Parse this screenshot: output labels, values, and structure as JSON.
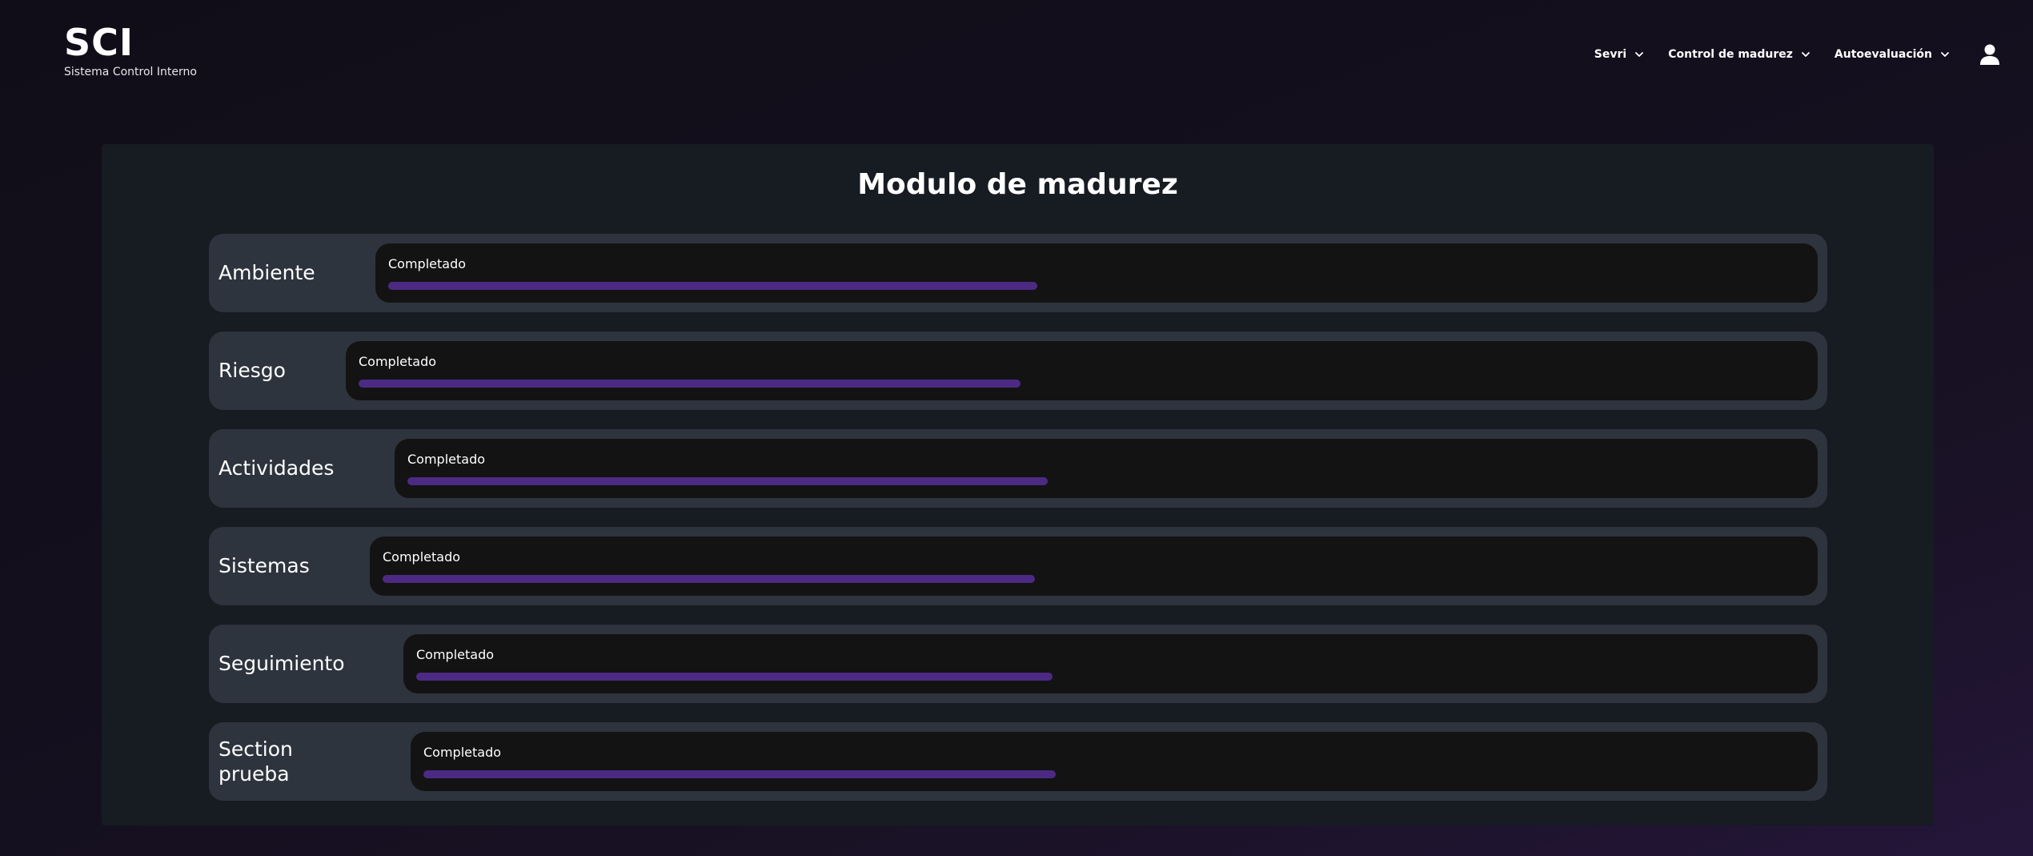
{
  "brand": {
    "logo": "SCI",
    "tagline": "Sistema Control Interno"
  },
  "nav": {
    "items": [
      {
        "label": "Sevri",
        "icon": "chevron-down-icon"
      },
      {
        "label": "Control de madurez",
        "icon": "chevron-down-icon"
      },
      {
        "label": "Autoevaluación",
        "icon": "chevron-down-icon"
      }
    ],
    "user_icon": "user-icon"
  },
  "main": {
    "title": "Modulo de madurez",
    "sections": [
      {
        "name": "Ambiente",
        "status": "Completado",
        "progress": 0.45
      },
      {
        "name": "Riesgo",
        "status": "Completado",
        "progress": 0.45
      },
      {
        "name": "Actividades",
        "status": "Completado",
        "progress": 0.45
      },
      {
        "name": "Sistemas",
        "status": "Completado",
        "progress": 0.45
      },
      {
        "name": "Seguimiento",
        "status": "Completado",
        "progress": 0.45
      },
      {
        "name": "Section prueba",
        "status": "Completado",
        "progress": 0.45
      }
    ]
  },
  "colors": {
    "background": "#130f1d",
    "panel": "#171b22",
    "row": "#2e343d",
    "progress_box": "#131313",
    "progress_fill": "#4c2a84"
  }
}
